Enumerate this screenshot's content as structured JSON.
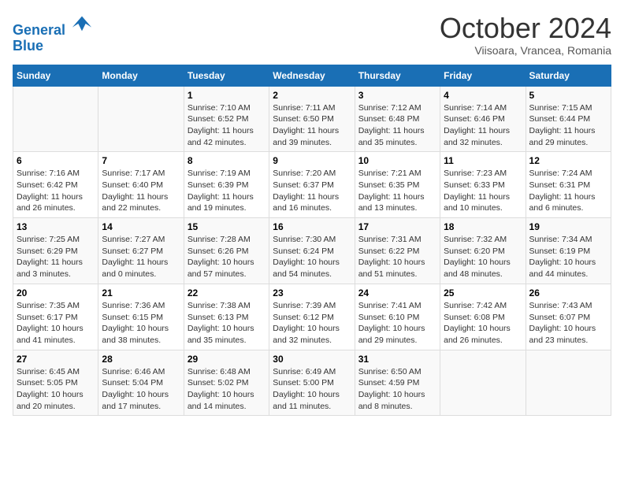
{
  "header": {
    "logo_line1": "General",
    "logo_line2": "Blue",
    "month": "October 2024",
    "location": "Viisoara, Vrancea, Romania"
  },
  "weekdays": [
    "Sunday",
    "Monday",
    "Tuesday",
    "Wednesday",
    "Thursday",
    "Friday",
    "Saturday"
  ],
  "weeks": [
    [
      {
        "day": "",
        "info": ""
      },
      {
        "day": "",
        "info": ""
      },
      {
        "day": "1",
        "info": "Sunrise: 7:10 AM\nSunset: 6:52 PM\nDaylight: 11 hours and 42 minutes."
      },
      {
        "day": "2",
        "info": "Sunrise: 7:11 AM\nSunset: 6:50 PM\nDaylight: 11 hours and 39 minutes."
      },
      {
        "day": "3",
        "info": "Sunrise: 7:12 AM\nSunset: 6:48 PM\nDaylight: 11 hours and 35 minutes."
      },
      {
        "day": "4",
        "info": "Sunrise: 7:14 AM\nSunset: 6:46 PM\nDaylight: 11 hours and 32 minutes."
      },
      {
        "day": "5",
        "info": "Sunrise: 7:15 AM\nSunset: 6:44 PM\nDaylight: 11 hours and 29 minutes."
      }
    ],
    [
      {
        "day": "6",
        "info": "Sunrise: 7:16 AM\nSunset: 6:42 PM\nDaylight: 11 hours and 26 minutes."
      },
      {
        "day": "7",
        "info": "Sunrise: 7:17 AM\nSunset: 6:40 PM\nDaylight: 11 hours and 22 minutes."
      },
      {
        "day": "8",
        "info": "Sunrise: 7:19 AM\nSunset: 6:39 PM\nDaylight: 11 hours and 19 minutes."
      },
      {
        "day": "9",
        "info": "Sunrise: 7:20 AM\nSunset: 6:37 PM\nDaylight: 11 hours and 16 minutes."
      },
      {
        "day": "10",
        "info": "Sunrise: 7:21 AM\nSunset: 6:35 PM\nDaylight: 11 hours and 13 minutes."
      },
      {
        "day": "11",
        "info": "Sunrise: 7:23 AM\nSunset: 6:33 PM\nDaylight: 11 hours and 10 minutes."
      },
      {
        "day": "12",
        "info": "Sunrise: 7:24 AM\nSunset: 6:31 PM\nDaylight: 11 hours and 6 minutes."
      }
    ],
    [
      {
        "day": "13",
        "info": "Sunrise: 7:25 AM\nSunset: 6:29 PM\nDaylight: 11 hours and 3 minutes."
      },
      {
        "day": "14",
        "info": "Sunrise: 7:27 AM\nSunset: 6:27 PM\nDaylight: 11 hours and 0 minutes."
      },
      {
        "day": "15",
        "info": "Sunrise: 7:28 AM\nSunset: 6:26 PM\nDaylight: 10 hours and 57 minutes."
      },
      {
        "day": "16",
        "info": "Sunrise: 7:30 AM\nSunset: 6:24 PM\nDaylight: 10 hours and 54 minutes."
      },
      {
        "day": "17",
        "info": "Sunrise: 7:31 AM\nSunset: 6:22 PM\nDaylight: 10 hours and 51 minutes."
      },
      {
        "day": "18",
        "info": "Sunrise: 7:32 AM\nSunset: 6:20 PM\nDaylight: 10 hours and 48 minutes."
      },
      {
        "day": "19",
        "info": "Sunrise: 7:34 AM\nSunset: 6:19 PM\nDaylight: 10 hours and 44 minutes."
      }
    ],
    [
      {
        "day": "20",
        "info": "Sunrise: 7:35 AM\nSunset: 6:17 PM\nDaylight: 10 hours and 41 minutes."
      },
      {
        "day": "21",
        "info": "Sunrise: 7:36 AM\nSunset: 6:15 PM\nDaylight: 10 hours and 38 minutes."
      },
      {
        "day": "22",
        "info": "Sunrise: 7:38 AM\nSunset: 6:13 PM\nDaylight: 10 hours and 35 minutes."
      },
      {
        "day": "23",
        "info": "Sunrise: 7:39 AM\nSunset: 6:12 PM\nDaylight: 10 hours and 32 minutes."
      },
      {
        "day": "24",
        "info": "Sunrise: 7:41 AM\nSunset: 6:10 PM\nDaylight: 10 hours and 29 minutes."
      },
      {
        "day": "25",
        "info": "Sunrise: 7:42 AM\nSunset: 6:08 PM\nDaylight: 10 hours and 26 minutes."
      },
      {
        "day": "26",
        "info": "Sunrise: 7:43 AM\nSunset: 6:07 PM\nDaylight: 10 hours and 23 minutes."
      }
    ],
    [
      {
        "day": "27",
        "info": "Sunrise: 6:45 AM\nSunset: 5:05 PM\nDaylight: 10 hours and 20 minutes."
      },
      {
        "day": "28",
        "info": "Sunrise: 6:46 AM\nSunset: 5:04 PM\nDaylight: 10 hours and 17 minutes."
      },
      {
        "day": "29",
        "info": "Sunrise: 6:48 AM\nSunset: 5:02 PM\nDaylight: 10 hours and 14 minutes."
      },
      {
        "day": "30",
        "info": "Sunrise: 6:49 AM\nSunset: 5:00 PM\nDaylight: 10 hours and 11 minutes."
      },
      {
        "day": "31",
        "info": "Sunrise: 6:50 AM\nSunset: 4:59 PM\nDaylight: 10 hours and 8 minutes."
      },
      {
        "day": "",
        "info": ""
      },
      {
        "day": "",
        "info": ""
      }
    ]
  ]
}
